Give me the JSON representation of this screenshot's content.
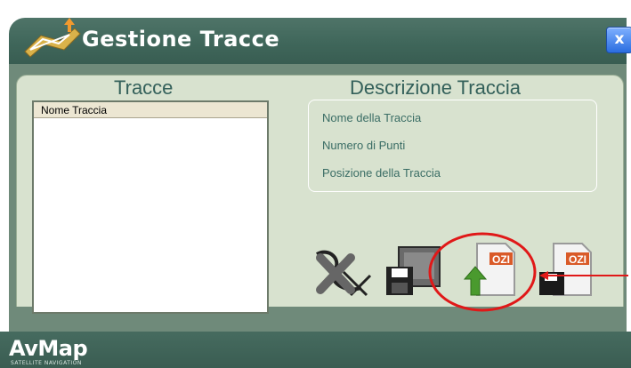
{
  "window": {
    "title": "Gestione Tracce",
    "close_label": "x"
  },
  "tracks": {
    "heading": "Tracce",
    "column_header": "Nome Traccia",
    "rows": []
  },
  "description": {
    "heading": "Descrizione Traccia",
    "fields": [
      "Nome della Traccia",
      "Numero di Punti",
      "Posizione della Traccia"
    ]
  },
  "toolbar": {
    "icons": [
      "delete-track-icon",
      "save-track-icon",
      "import-ozi-icon",
      "export-ozi-icon"
    ],
    "ozi_label": "OZI"
  },
  "annotation": {
    "color": "#e01818"
  },
  "footer": {
    "logo": "AvMap",
    "logo_sub": "SATELLITE NAVIGATION"
  }
}
